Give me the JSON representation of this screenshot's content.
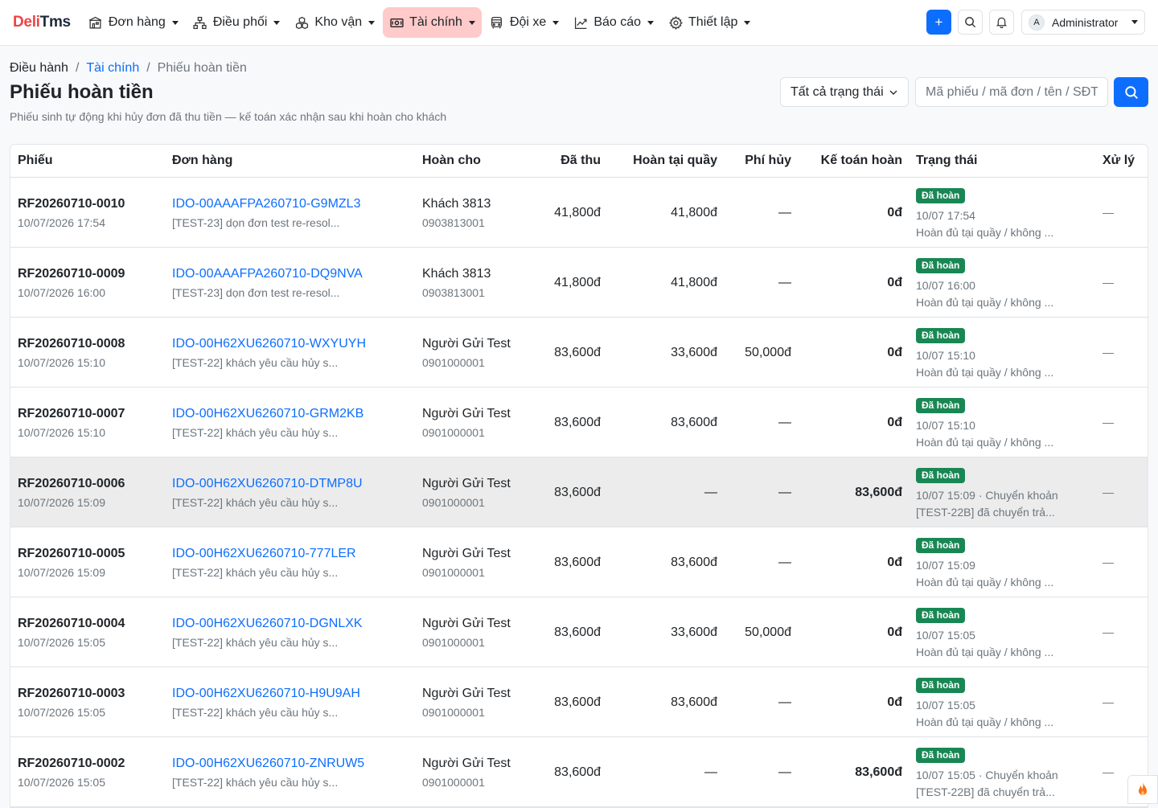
{
  "brand": {
    "part1": "Deli",
    "part2": "Tms"
  },
  "nav": [
    {
      "label": "Đơn hàng",
      "icon": "building-icon"
    },
    {
      "label": "Điều phối",
      "icon": "network-icon"
    },
    {
      "label": "Kho vận",
      "icon": "boxes-icon"
    },
    {
      "label": "Tài chính",
      "icon": "cash-icon",
      "active": true
    },
    {
      "label": "Đội xe",
      "icon": "bus-icon"
    },
    {
      "label": "Báo cáo",
      "icon": "chart-icon"
    },
    {
      "label": "Thiết lập",
      "icon": "gear-icon"
    }
  ],
  "topright": {
    "add": "+",
    "avatar_letter": "A",
    "user": "Administrator"
  },
  "breadcrumb": [
    "Điều hành",
    "Tài chính",
    "Phiếu hoàn tiền"
  ],
  "page": {
    "title": "Phiếu hoàn tiền",
    "subtitle": "Phiếu sinh tự động khi hủy đơn đã thu tiền — kế toán xác nhận sau khi hoàn cho khách"
  },
  "filters": {
    "status": "Tất cả trạng thái",
    "search_placeholder": "Mã phiếu / mã đơn / tên / SĐT"
  },
  "table": {
    "columns": [
      "Phiếu",
      "Đơn hàng",
      "Hoàn cho",
      "Đã thu",
      "Hoàn tại quầy",
      "Phí hủy",
      "Kế toán hoàn",
      "Trạng thái",
      "Xử lý"
    ],
    "rows": [
      {
        "code": "RF20260710-0010",
        "date": "10/07/2026 17:54",
        "order": "IDO-00AAAFPA260710-G9MZL3",
        "note": "[TEST-23] dọn đơn test re-resol...",
        "name": "Khách 3813",
        "phone": "0903813001",
        "paid": "41,800đ",
        "counter": "41,800đ",
        "fee": "—",
        "acc": "0đ",
        "badge": "Đã hoàn",
        "time": "10/07 17:54",
        "desc": "Hoàn đủ tại quầy / không ...",
        "action": "—"
      },
      {
        "code": "RF20260710-0009",
        "date": "10/07/2026 16:00",
        "order": "IDO-00AAAFPA260710-DQ9NVA",
        "note": "[TEST-23] dọn đơn test re-resol...",
        "name": "Khách 3813",
        "phone": "0903813001",
        "paid": "41,800đ",
        "counter": "41,800đ",
        "fee": "—",
        "acc": "0đ",
        "badge": "Đã hoàn",
        "time": "10/07 16:00",
        "desc": "Hoàn đủ tại quầy / không ...",
        "action": "—"
      },
      {
        "code": "RF20260710-0008",
        "date": "10/07/2026 15:10",
        "order": "IDO-00H62XU6260710-WXYUYH",
        "note": "[TEST-22] khách yêu cầu hủy s...",
        "name": "Người Gửi Test",
        "phone": "0901000001",
        "paid": "83,600đ",
        "counter": "33,600đ",
        "fee": "50,000đ",
        "acc": "0đ",
        "badge": "Đã hoàn",
        "time": "10/07 15:10",
        "desc": "Hoàn đủ tại quầy / không ...",
        "action": "—"
      },
      {
        "code": "RF20260710-0007",
        "date": "10/07/2026 15:10",
        "order": "IDO-00H62XU6260710-GRM2KB",
        "note": "[TEST-22] khách yêu cầu hủy s...",
        "name": "Người Gửi Test",
        "phone": "0901000001",
        "paid": "83,600đ",
        "counter": "83,600đ",
        "fee": "—",
        "acc": "0đ",
        "badge": "Đã hoàn",
        "time": "10/07 15:10",
        "desc": "Hoàn đủ tại quầy / không ...",
        "action": "—"
      },
      {
        "code": "RF20260710-0006",
        "date": "10/07/2026 15:09",
        "order": "IDO-00H62XU6260710-DTMP8U",
        "note": "[TEST-22] khách yêu cầu hủy s...",
        "name": "Người Gửi Test",
        "phone": "0901000001",
        "paid": "83,600đ",
        "counter": "—",
        "fee": "—",
        "acc": "83,600đ",
        "badge": "Đã hoàn",
        "time": "10/07 15:09 · Chuyển khoản",
        "desc": "[TEST-22B] đã chuyển trả...",
        "action": "—",
        "highlight": true
      },
      {
        "code": "RF20260710-0005",
        "date": "10/07/2026 15:09",
        "order": "IDO-00H62XU6260710-777LER",
        "note": "[TEST-22] khách yêu cầu hủy s...",
        "name": "Người Gửi Test",
        "phone": "0901000001",
        "paid": "83,600đ",
        "counter": "83,600đ",
        "fee": "—",
        "acc": "0đ",
        "badge": "Đã hoàn",
        "time": "10/07 15:09",
        "desc": "Hoàn đủ tại quầy / không ...",
        "action": "—"
      },
      {
        "code": "RF20260710-0004",
        "date": "10/07/2026 15:05",
        "order": "IDO-00H62XU6260710-DGNLXK",
        "note": "[TEST-22] khách yêu cầu hủy s...",
        "name": "Người Gửi Test",
        "phone": "0901000001",
        "paid": "83,600đ",
        "counter": "33,600đ",
        "fee": "50,000đ",
        "acc": "0đ",
        "badge": "Đã hoàn",
        "time": "10/07 15:05",
        "desc": "Hoàn đủ tại quầy / không ...",
        "action": "—"
      },
      {
        "code": "RF20260710-0003",
        "date": "10/07/2026 15:05",
        "order": "IDO-00H62XU6260710-H9U9AH",
        "note": "[TEST-22] khách yêu cầu hủy s...",
        "name": "Người Gửi Test",
        "phone": "0901000001",
        "paid": "83,600đ",
        "counter": "83,600đ",
        "fee": "—",
        "acc": "0đ",
        "badge": "Đã hoàn",
        "time": "10/07 15:05",
        "desc": "Hoàn đủ tại quầy / không ...",
        "action": "—"
      },
      {
        "code": "RF20260710-0002",
        "date": "10/07/2026 15:05",
        "order": "IDO-00H62XU6260710-ZNRUW5",
        "note": "[TEST-22] khách yêu cầu hủy s...",
        "name": "Người Gửi Test",
        "phone": "0901000001",
        "paid": "83,600đ",
        "counter": "—",
        "fee": "—",
        "acc": "83,600đ",
        "badge": "Đã hoàn",
        "time": "10/07 15:05 · Chuyển khoản",
        "desc": "[TEST-22B] đã chuyển trả...",
        "action": "—"
      }
    ]
  },
  "colors": {
    "accent": "#0d6efd",
    "brand_red": "#ef4444",
    "success": "#198754",
    "active_nav": "#fecaca"
  }
}
